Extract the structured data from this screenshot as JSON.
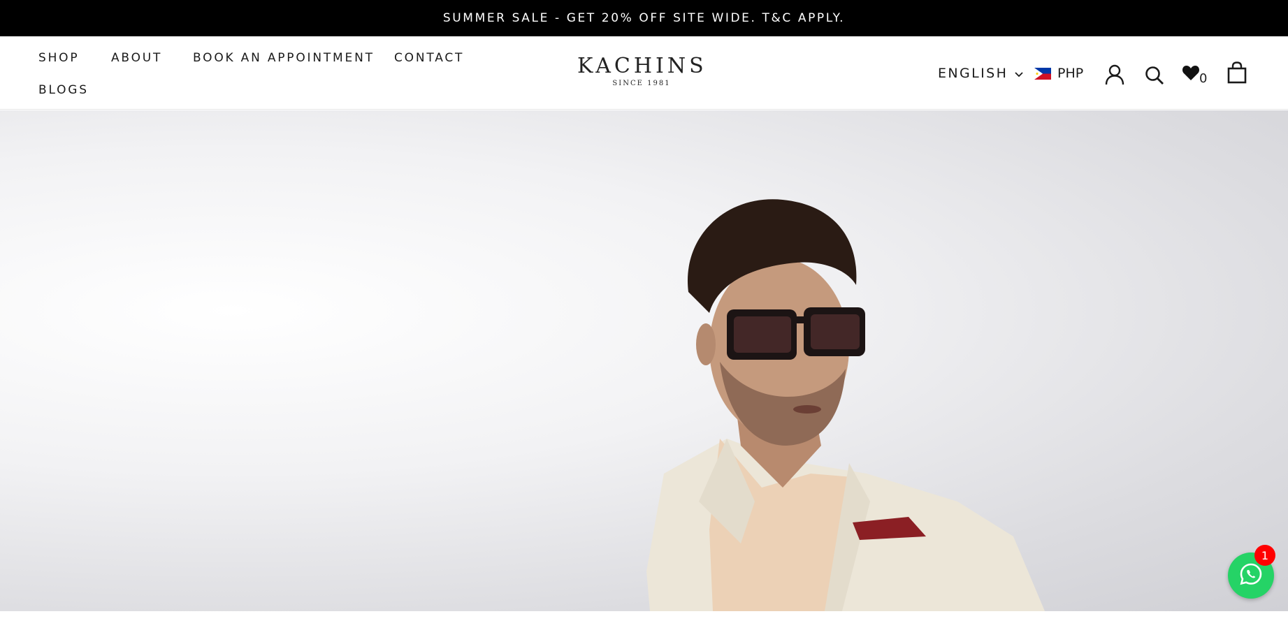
{
  "announcement": {
    "text": "SUMMER SALE - GET 20% OFF SITE WIDE. T&C APPLY."
  },
  "nav": {
    "shop": "SHOP",
    "about": "ABOUT",
    "book": "BOOK AN APPOINTMENT",
    "contact": "CONTACT",
    "blogs": "BLOGS"
  },
  "logo": {
    "name": "KACHINS",
    "tagline": "SINCE 1981"
  },
  "header_right": {
    "language": "ENGLISH",
    "currency": "PHP",
    "currency_flag": "philippines-flag-icon",
    "account_icon": "user-icon",
    "search_icon": "search-icon",
    "wishlist_icon": "heart-icon",
    "wishlist_count": "0",
    "cart_icon": "shopping-bag-icon"
  },
  "hero": {
    "image": "man-in-sunglasses-cream-pinstripe-blazer"
  },
  "chat_widget": {
    "icon": "whatsapp-icon",
    "badge_count": "1",
    "color": "#25d366",
    "badge_color": "#ff0000"
  },
  "colors": {
    "announce_bg": "#000000",
    "text": "#1a1a1a"
  }
}
